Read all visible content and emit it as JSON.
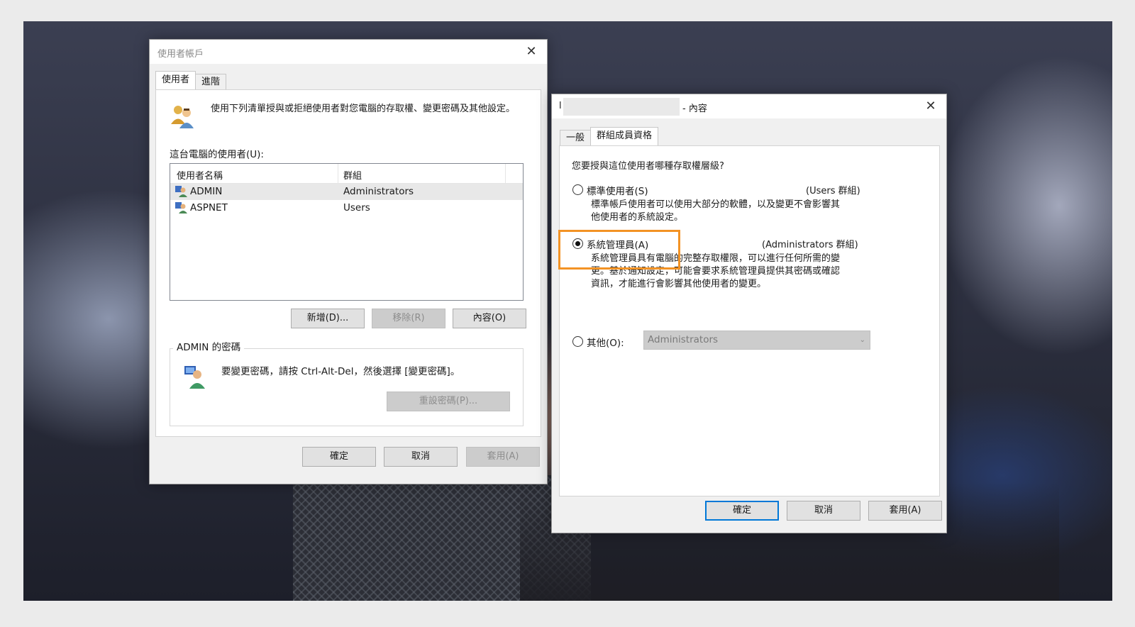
{
  "user_accounts": {
    "title": "使用者帳戶",
    "tabs": [
      "使用者",
      "進階"
    ],
    "intro": "使用下列清單授與或拒絕使用者對您電腦的存取權、變更密碼及其他設定。",
    "users_label": "這台電腦的使用者(U):",
    "columns": [
      "使用者名稱",
      "群組"
    ],
    "users": [
      {
        "name": "ADMIN",
        "group": "Administrators"
      },
      {
        "name": "ASPNET",
        "group": "Users"
      }
    ],
    "buttons": {
      "add": "新增(D)...",
      "remove": "移除(R)",
      "properties": "內容(O)"
    },
    "password_group_title": "ADMIN 的密碼",
    "password_text": "要變更密碼，請按 Ctrl-Alt-Del，然後選擇 [變更密碼]。",
    "reset_password": "重設密碼(P)...",
    "ok": "確定",
    "cancel": "取消",
    "apply": "套用(A)"
  },
  "properties": {
    "title_prefix": "l",
    "title_suffix": "- 內容",
    "tabs": [
      "一般",
      "群組成員資格"
    ],
    "question": "您要授與這位使用者哪種存取權層級?",
    "standard": {
      "label": "標準使用者(S)",
      "group": "(Users 群組)",
      "desc1": "標準帳戶使用者可以使用大部分的軟體，以及變更不會影響其",
      "desc2": "他使用者的系統設定。"
    },
    "admin": {
      "label": "系統管理員(A)",
      "group": "(Administrators 群組)",
      "desc1": "系統管理員具有電腦的完整存取權限，可以進行任何所需的變",
      "desc2": "更。基於通知設定，可能會要求系統管理員提供其密碼或確認",
      "desc3": "資訊，才能進行會影響其他使用者的變更。"
    },
    "other": {
      "label": "其他(O):",
      "value": "Administrators"
    },
    "ok": "確定",
    "cancel": "取消",
    "apply": "套用(A)"
  },
  "colors": {
    "highlight": "#f39325",
    "accent": "#0078d7"
  }
}
